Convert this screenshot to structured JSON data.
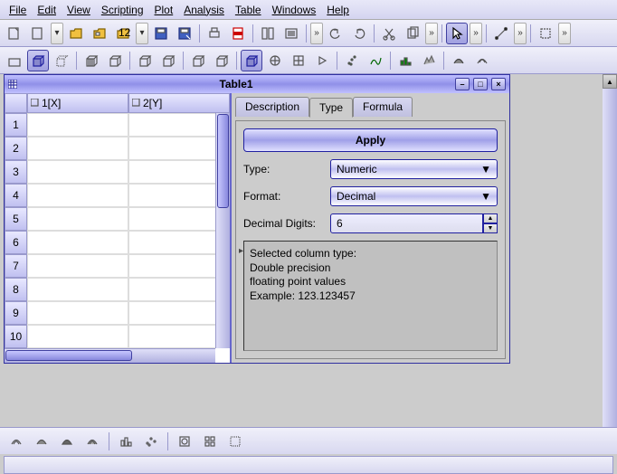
{
  "menu": [
    "File",
    "Edit",
    "View",
    "Scripting",
    "Plot",
    "Analysis",
    "Table",
    "Windows",
    "Help"
  ],
  "window": {
    "title": "Table1",
    "columns": [
      "1[X]",
      "2[Y]"
    ],
    "rows": [
      "1",
      "2",
      "3",
      "4",
      "5",
      "6",
      "7",
      "8",
      "9",
      "10"
    ]
  },
  "panel": {
    "tabs": [
      "Description",
      "Type",
      "Formula"
    ],
    "active_tab": "Type",
    "apply": "Apply",
    "type_label": "Type:",
    "type_value": "Numeric",
    "format_label": "Format:",
    "format_value": "Decimal",
    "digits_label": "Decimal Digits:",
    "digits_value": "6",
    "info_lines": [
      "Selected column type:",
      "Double precision",
      "floating point values",
      "Example: 123.123457"
    ]
  }
}
